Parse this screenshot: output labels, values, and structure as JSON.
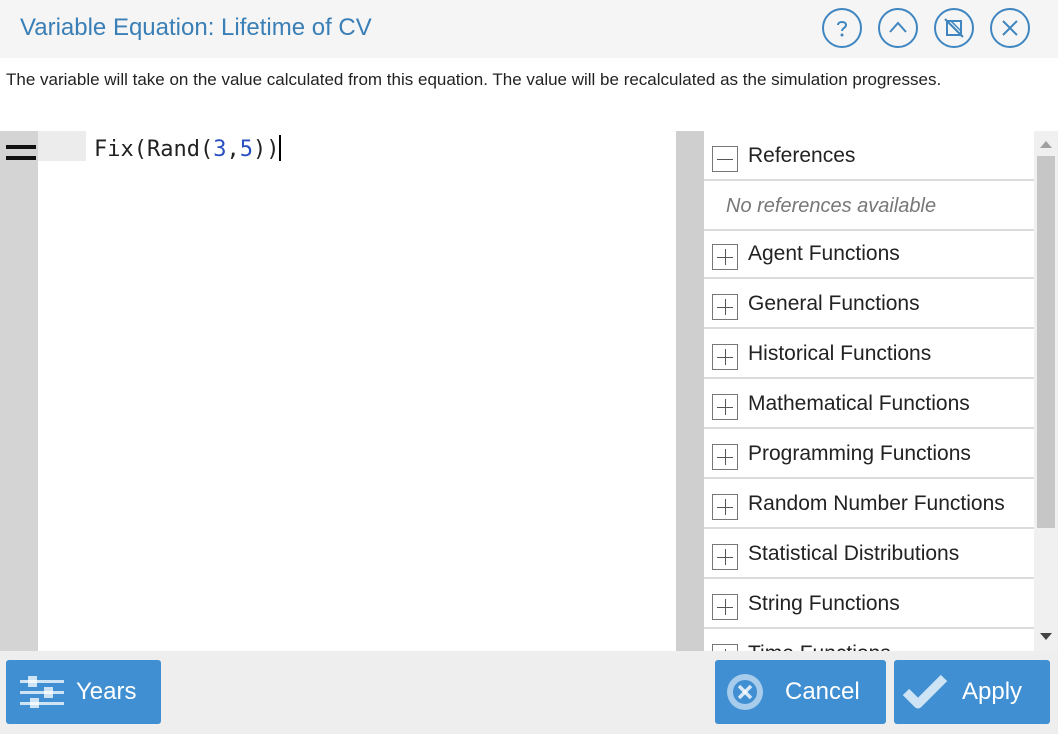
{
  "header": {
    "title": "Variable Equation: Lifetime of CV",
    "icons": [
      "help-icon",
      "collapse-icon",
      "maximize-icon",
      "close-icon"
    ]
  },
  "description": "The variable will take on the value calculated from this equation. The value will be recalculated as the simulation progresses.",
  "editor": {
    "code_prefix": "Fix(Rand(",
    "code_num1": "3",
    "code_sep": ",",
    "code_num2": "5",
    "code_suffix": "))"
  },
  "references": {
    "header_label": "References",
    "empty_text": "No references available",
    "categories": [
      "Agent Functions",
      "General Functions",
      "Historical Functions",
      "Mathematical Functions",
      "Programming Functions",
      "Random Number Functions",
      "Statistical Distributions",
      "String Functions",
      "Time Functions"
    ]
  },
  "footer": {
    "units_label": "Years",
    "cancel_label": "Cancel",
    "apply_label": "Apply"
  },
  "colors": {
    "accent": "#3f8fd2",
    "title": "#3a7fb6",
    "number_token": "#2a4fc0"
  }
}
